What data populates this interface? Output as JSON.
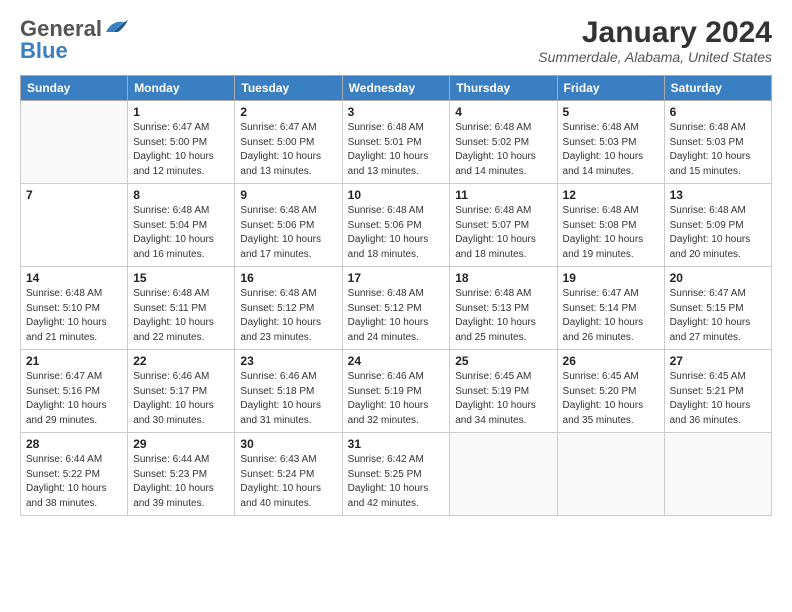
{
  "logo": {
    "general": "General",
    "blue": "Blue"
  },
  "header": {
    "title": "January 2024",
    "location": "Summerdale, Alabama, United States"
  },
  "weekdays": [
    "Sunday",
    "Monday",
    "Tuesday",
    "Wednesday",
    "Thursday",
    "Friday",
    "Saturday"
  ],
  "weeks": [
    [
      {
        "day": "",
        "info": ""
      },
      {
        "day": "1",
        "info": "Sunrise: 6:47 AM\nSunset: 5:00 PM\nDaylight: 10 hours\nand 12 minutes."
      },
      {
        "day": "2",
        "info": "Sunrise: 6:47 AM\nSunset: 5:00 PM\nDaylight: 10 hours\nand 13 minutes."
      },
      {
        "day": "3",
        "info": "Sunrise: 6:48 AM\nSunset: 5:01 PM\nDaylight: 10 hours\nand 13 minutes."
      },
      {
        "day": "4",
        "info": "Sunrise: 6:48 AM\nSunset: 5:02 PM\nDaylight: 10 hours\nand 14 minutes."
      },
      {
        "day": "5",
        "info": "Sunrise: 6:48 AM\nSunset: 5:03 PM\nDaylight: 10 hours\nand 14 minutes."
      },
      {
        "day": "6",
        "info": "Sunrise: 6:48 AM\nSunset: 5:03 PM\nDaylight: 10 hours\nand 15 minutes."
      }
    ],
    [
      {
        "day": "7",
        "info": ""
      },
      {
        "day": "8",
        "info": "Sunrise: 6:48 AM\nSunset: 5:04 PM\nDaylight: 10 hours\nand 16 minutes."
      },
      {
        "day": "9",
        "info": "Sunrise: 6:48 AM\nSunset: 5:06 PM\nDaylight: 10 hours\nand 17 minutes."
      },
      {
        "day": "10",
        "info": "Sunrise: 6:48 AM\nSunset: 5:06 PM\nDaylight: 10 hours\nand 18 minutes."
      },
      {
        "day": "11",
        "info": "Sunrise: 6:48 AM\nSunset: 5:07 PM\nDaylight: 10 hours\nand 18 minutes."
      },
      {
        "day": "12",
        "info": "Sunrise: 6:48 AM\nSunset: 5:08 PM\nDaylight: 10 hours\nand 19 minutes."
      },
      {
        "day": "13",
        "info": "Sunrise: 6:48 AM\nSunset: 5:09 PM\nDaylight: 10 hours\nand 20 minutes."
      }
    ],
    [
      {
        "day": "14",
        "info": "Sunrise: 6:48 AM\nSunset: 5:10 PM\nDaylight: 10 hours\nand 21 minutes."
      },
      {
        "day": "15",
        "info": "Sunrise: 6:48 AM\nSunset: 5:11 PM\nDaylight: 10 hours\nand 22 minutes."
      },
      {
        "day": "16",
        "info": "Sunrise: 6:48 AM\nSunset: 5:12 PM\nDaylight: 10 hours\nand 23 minutes."
      },
      {
        "day": "17",
        "info": "Sunrise: 6:48 AM\nSunset: 5:12 PM\nDaylight: 10 hours\nand 24 minutes."
      },
      {
        "day": "18",
        "info": "Sunrise: 6:48 AM\nSunset: 5:13 PM\nDaylight: 10 hours\nand 25 minutes."
      },
      {
        "day": "19",
        "info": "Sunrise: 6:47 AM\nSunset: 5:14 PM\nDaylight: 10 hours\nand 26 minutes."
      },
      {
        "day": "20",
        "info": "Sunrise: 6:47 AM\nSunset: 5:15 PM\nDaylight: 10 hours\nand 27 minutes."
      }
    ],
    [
      {
        "day": "21",
        "info": "Sunrise: 6:47 AM\nSunset: 5:16 PM\nDaylight: 10 hours\nand 29 minutes."
      },
      {
        "day": "22",
        "info": "Sunrise: 6:46 AM\nSunset: 5:17 PM\nDaylight: 10 hours\nand 30 minutes."
      },
      {
        "day": "23",
        "info": "Sunrise: 6:46 AM\nSunset: 5:18 PM\nDaylight: 10 hours\nand 31 minutes."
      },
      {
        "day": "24",
        "info": "Sunrise: 6:46 AM\nSunset: 5:19 PM\nDaylight: 10 hours\nand 32 minutes."
      },
      {
        "day": "25",
        "info": "Sunrise: 6:45 AM\nSunset: 5:19 PM\nDaylight: 10 hours\nand 34 minutes."
      },
      {
        "day": "26",
        "info": "Sunrise: 6:45 AM\nSunset: 5:20 PM\nDaylight: 10 hours\nand 35 minutes."
      },
      {
        "day": "27",
        "info": "Sunrise: 6:45 AM\nSunset: 5:21 PM\nDaylight: 10 hours\nand 36 minutes."
      }
    ],
    [
      {
        "day": "28",
        "info": "Sunrise: 6:44 AM\nSunset: 5:22 PM\nDaylight: 10 hours\nand 38 minutes."
      },
      {
        "day": "29",
        "info": "Sunrise: 6:44 AM\nSunset: 5:23 PM\nDaylight: 10 hours\nand 39 minutes."
      },
      {
        "day": "30",
        "info": "Sunrise: 6:43 AM\nSunset: 5:24 PM\nDaylight: 10 hours\nand 40 minutes."
      },
      {
        "day": "31",
        "info": "Sunrise: 6:42 AM\nSunset: 5:25 PM\nDaylight: 10 hours\nand 42 minutes."
      },
      {
        "day": "",
        "info": ""
      },
      {
        "day": "",
        "info": ""
      },
      {
        "day": "",
        "info": ""
      }
    ]
  ]
}
